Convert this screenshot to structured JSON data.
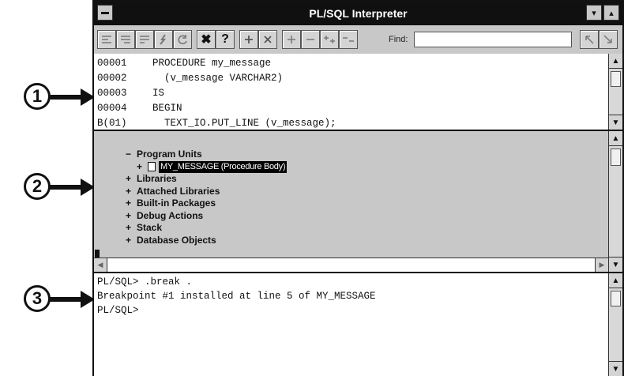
{
  "window": {
    "title": "PL/SQL Interpreter",
    "minimize_glyph": "▾",
    "maximize_glyph": "▴"
  },
  "callouts": [
    "1",
    "2",
    "3"
  ],
  "toolbar": {
    "icons": [
      "step-into-icon",
      "step-over-icon",
      "step-out-icon",
      "go-icon",
      "reset-icon",
      "close-icon",
      "help-icon",
      "break-icon",
      "remove-break-icon",
      "expand-icon",
      "collapse-icon",
      "expand-all-icon",
      "collapse-all-icon",
      "find-prev-icon",
      "find-next-icon"
    ],
    "close_glyph": "✖",
    "help_glyph": "?",
    "find_label": "Find:",
    "find_value": ""
  },
  "source_pane": {
    "lines": [
      {
        "num": "00001",
        "text": "PROCEDURE my_message"
      },
      {
        "num": "00002",
        "text": "  (v_message VARCHAR2)"
      },
      {
        "num": "00003",
        "text": "IS"
      },
      {
        "num": "00004",
        "text": "BEGIN"
      },
      {
        "num": "B(01)",
        "text": "  TEXT_IO.PUT_LINE (v_message);"
      }
    ]
  },
  "navigator_pane": {
    "nodes": [
      {
        "marker": "−",
        "label": "Program Units",
        "level": 0
      },
      {
        "marker": "+",
        "label": "MY_MESSAGE (Procedure Body)",
        "level": 1,
        "selected": true
      },
      {
        "marker": "+",
        "label": "Libraries",
        "level": 0
      },
      {
        "marker": "+",
        "label": "Attached Libraries",
        "level": 0
      },
      {
        "marker": "+",
        "label": "Built-in Packages",
        "level": 0
      },
      {
        "marker": "+",
        "label": "Debug Actions",
        "level": 0
      },
      {
        "marker": "+",
        "label": "Stack",
        "level": 0
      },
      {
        "marker": "+",
        "label": "Database Objects",
        "level": 0
      }
    ]
  },
  "console_pane": {
    "lines": [
      "PL/SQL> .break .",
      "Breakpoint #1 installed at line 5 of MY_MESSAGE",
      "PL/SQL>"
    ]
  },
  "colors": {
    "titlebar": "#101010",
    "chrome": "#c8c8c8",
    "selection": "#000000"
  }
}
